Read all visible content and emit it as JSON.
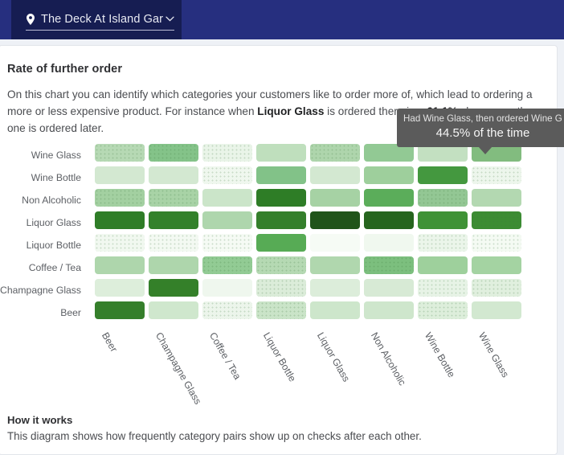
{
  "topbar": {
    "location_name": "The Deck At Island Gar",
    "pin_icon": "map-pin-icon",
    "chevron_icon": "chevron-down-icon",
    "bg_color": "#262f7f",
    "panel_color": "#161d52"
  },
  "card": {
    "title": "Rate of further order",
    "description_prefix": "On this chart you can identify which categories your customers like to order more of, which lead to ordering a more or less expensive product. For instance when ",
    "description_bold1": "Liquor Glass",
    "description_mid": " is ordered there is a ",
    "description_bold2": "61.1%",
    "description_suffix": " chance another one is ordered later.",
    "how_it_works_title": "How it works",
    "how_it_works_body": "This diagram shows how frequently category pairs show up on checks after each other."
  },
  "tooltip": {
    "line1": "Had Wine Glass, then ordered Wine Glass",
    "line2": "44.5% of the time",
    "bg_color": "#5b5b5b"
  },
  "chart_data": {
    "type": "heatmap",
    "title": "Rate of further order",
    "xlabel": "",
    "ylabel": "",
    "legend": "none",
    "grid": false,
    "colorscale": [
      "#f7fbf7",
      "#e3f0e3",
      "#cbe5cc",
      "#ade0b0",
      "#8ecb92",
      "#6cb96f",
      "#4c9e4e",
      "#337a2d",
      "#275f20"
    ],
    "value_unit": "%",
    "value_range": [
      0,
      61.1
    ],
    "x_categories": [
      "Beer",
      "Champagne Glass",
      "Coffee / Tea",
      "Liquor Bottle",
      "Liquor Glass",
      "Non Alcoholic",
      "Wine Bottle",
      "Wine Glass"
    ],
    "y_categories": [
      "Wine Glass",
      "Wine Bottle",
      "Non Alcoholic",
      "Liquor Glass",
      "Liquor Bottle",
      "Coffee / Tea",
      "Champagne Glass",
      "Beer"
    ],
    "rows": [
      {
        "label": "Wine Glass",
        "cells": [
          {
            "x": "Beer",
            "value": 22,
            "color": "#b6d9b4",
            "textured": true
          },
          {
            "x": "Champagne Glass",
            "value": 34,
            "color": "#84c389",
            "textured": true
          },
          {
            "x": "Coffee / Tea",
            "value": 8,
            "color": "#e9f4e8",
            "textured": true
          },
          {
            "x": "Liquor Bottle",
            "value": 20,
            "color": "#bfdfbd",
            "textured": false
          },
          {
            "x": "Liquor Glass",
            "value": 24,
            "color": "#aed5ac",
            "textured": true
          },
          {
            "x": "Non Alcoholic",
            "value": 31,
            "color": "#92c994",
            "textured": false
          },
          {
            "x": "Wine Bottle",
            "value": 19,
            "color": "#c3e0c1",
            "textured": false
          },
          {
            "x": "Wine Glass",
            "value": 44.5,
            "color": "#82bc7f",
            "textured": false
          }
        ]
      },
      {
        "label": "Wine Bottle",
        "cells": [
          {
            "x": "Beer",
            "value": 15,
            "color": "#d3e8d1",
            "textured": false
          },
          {
            "x": "Champagne Glass",
            "value": 15,
            "color": "#d3e8d1",
            "textured": false
          },
          {
            "x": "Coffee / Tea",
            "value": 6,
            "color": "#eff7ee",
            "textured": true
          },
          {
            "x": "Liquor Bottle",
            "value": 33,
            "color": "#82c288",
            "textured": false
          },
          {
            "x": "Liquor Glass",
            "value": 14,
            "color": "#d3e8d1",
            "textured": false
          },
          {
            "x": "Non Alcoholic",
            "value": 28,
            "color": "#9ecf9c",
            "textured": false
          },
          {
            "x": "Wine Bottle",
            "value": 41,
            "color": "#44983f",
            "textured": false
          },
          {
            "x": "Wine Glass",
            "value": 7,
            "color": "#edf6ec",
            "textured": true
          }
        ]
      },
      {
        "label": "Non Alcoholic",
        "cells": [
          {
            "x": "Beer",
            "value": 27,
            "color": "#a3d0a1",
            "textured": true
          },
          {
            "x": "Champagne Glass",
            "value": 26,
            "color": "#a8d3a6",
            "textured": true
          },
          {
            "x": "Coffee / Tea",
            "value": 16,
            "color": "#cbe5c9",
            "textured": false
          },
          {
            "x": "Liquor Bottle",
            "value": 49,
            "color": "#2e7d26",
            "textured": false
          },
          {
            "x": "Liquor Glass",
            "value": 26,
            "color": "#a6d2a4",
            "textured": false
          },
          {
            "x": "Non Alcoholic",
            "value": 35,
            "color": "#5bad5a",
            "textured": false
          },
          {
            "x": "Wine Bottle",
            "value": 29,
            "color": "#93c794",
            "textured": true
          },
          {
            "x": "Wine Glass",
            "value": 22,
            "color": "#b3d8b1",
            "textured": false
          }
        ]
      },
      {
        "label": "Liquor Glass",
        "cells": [
          {
            "x": "Beer",
            "value": 47,
            "color": "#2f7d27",
            "textured": false
          },
          {
            "x": "Champagne Glass",
            "value": 46,
            "color": "#33812b",
            "textured": false
          },
          {
            "x": "Coffee / Tea",
            "value": 23,
            "color": "#aed6ad",
            "textured": false
          },
          {
            "x": "Liquor Bottle",
            "value": 47,
            "color": "#347f2b",
            "textured": false
          },
          {
            "x": "Liquor Glass",
            "value": 61.1,
            "color": "#20541a",
            "textured": false
          },
          {
            "x": "Non Alcoholic",
            "value": 53,
            "color": "#26651e",
            "textured": false
          },
          {
            "x": "Wine Bottle",
            "value": 44,
            "color": "#3f9236",
            "textured": false
          },
          {
            "x": "Wine Glass",
            "value": 45,
            "color": "#3c8c33",
            "textured": true
          }
        ]
      },
      {
        "label": "Liquor Bottle",
        "cells": [
          {
            "x": "Beer",
            "value": 3,
            "color": "#f1f8f0",
            "textured": true
          },
          {
            "x": "Champagne Glass",
            "value": 3,
            "color": "#f3f9f2",
            "textured": true
          },
          {
            "x": "Coffee / Tea",
            "value": 2,
            "color": "#f5faf4",
            "textured": true
          },
          {
            "x": "Liquor Bottle",
            "value": 34,
            "color": "#57ab55",
            "textured": false
          },
          {
            "x": "Liquor Glass",
            "value": 2,
            "color": "#f6fbf5",
            "textured": false
          },
          {
            "x": "Non Alcoholic",
            "value": 3,
            "color": "#f0f8ef",
            "textured": false
          },
          {
            "x": "Wine Bottle",
            "value": 4,
            "color": "#ebf5ea",
            "textured": true
          },
          {
            "x": "Wine Glass",
            "value": 2,
            "color": "#f4faf3",
            "textured": true
          }
        ]
      },
      {
        "label": "Coffee / Tea",
        "cells": [
          {
            "x": "Beer",
            "value": 25,
            "color": "#aed6ac",
            "textured": false
          },
          {
            "x": "Champagne Glass",
            "value": 25,
            "color": "#aed6ac",
            "textured": false
          },
          {
            "x": "Coffee / Tea",
            "value": 29,
            "color": "#92cb94",
            "textured": true
          },
          {
            "x": "Liquor Bottle",
            "value": 24,
            "color": "#b5d9b3",
            "textured": true
          },
          {
            "x": "Liquor Glass",
            "value": 24,
            "color": "#b0d7ae",
            "textured": false
          },
          {
            "x": "Non Alcoholic",
            "value": 30,
            "color": "#7cbf7e",
            "textured": true
          },
          {
            "x": "Wine Bottle",
            "value": 27,
            "color": "#9ed09c",
            "textured": false
          },
          {
            "x": "Wine Glass",
            "value": 26,
            "color": "#a4d3a2",
            "textured": false
          }
        ]
      },
      {
        "label": "Champagne Glass",
        "cells": [
          {
            "x": "Beer",
            "value": 12,
            "color": "#ddeedb",
            "textured": false
          },
          {
            "x": "Champagne Glass",
            "value": 46,
            "color": "#348029",
            "textured": false
          },
          {
            "x": "Coffee / Tea",
            "value": 5,
            "color": "#eff7ee",
            "textured": false
          },
          {
            "x": "Liquor Bottle",
            "value": 13,
            "color": "#dbecd9",
            "textured": true
          },
          {
            "x": "Liquor Glass",
            "value": 13,
            "color": "#dcedda",
            "textured": false
          },
          {
            "x": "Non Alcoholic",
            "value": 14,
            "color": "#d7ead5",
            "textured": false
          },
          {
            "x": "Wine Bottle",
            "value": 9,
            "color": "#e7f3e6",
            "textured": true
          },
          {
            "x": "Wine Glass",
            "value": 11,
            "color": "#e0efde",
            "textured": true
          }
        ]
      },
      {
        "label": "Beer",
        "cells": [
          {
            "x": "Beer",
            "value": 47,
            "color": "#357f2b",
            "textured": false
          },
          {
            "x": "Champagne Glass",
            "value": 16,
            "color": "#cfe7cd",
            "textured": false
          },
          {
            "x": "Coffee / Tea",
            "value": 8,
            "color": "#ecf5eb",
            "textured": true
          },
          {
            "x": "Liquor Bottle",
            "value": 17,
            "color": "#cae4c8",
            "textured": true
          },
          {
            "x": "Liquor Glass",
            "value": 16,
            "color": "#cde6cb",
            "textured": false
          },
          {
            "x": "Non Alcoholic",
            "value": 16,
            "color": "#cee6cc",
            "textured": false
          },
          {
            "x": "Wine Bottle",
            "value": 12,
            "color": "#ddeedb",
            "textured": true
          },
          {
            "x": "Wine Glass",
            "value": 15,
            "color": "#d2e8d0",
            "textured": false
          }
        ]
      }
    ]
  }
}
